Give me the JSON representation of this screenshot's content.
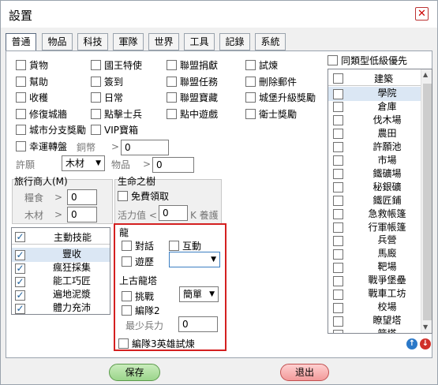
{
  "window": {
    "title": "設置"
  },
  "tabs": [
    "普通",
    "物品",
    "科技",
    "軍隊",
    "世界",
    "工具",
    "記錄",
    "系統"
  ],
  "options": {
    "col1": [
      "貨物",
      "幫助",
      "收穫",
      "修復城牆",
      "城市分支獎勵",
      "幸運轉盤"
    ],
    "col2": [
      "國王特使",
      "簽到",
      "日常",
      "點擊士兵",
      "VIP寶箱"
    ],
    "col3": [
      "聯盟捐獻",
      "聯盟任務",
      "聯盟寶藏",
      "點中遊戲"
    ],
    "col4": [
      "試煉",
      "刪除郵件",
      "城堡升級獎勵",
      "衛士獎勵"
    ]
  },
  "lucky": {
    "coins_label": "銅幣",
    "gt": ">",
    "value": "0"
  },
  "tribute": {
    "label": "許願",
    "select": "木材",
    "item_label": "物品",
    "gt": ">",
    "value": "0"
  },
  "merchant": {
    "title": "旅行商人(M)",
    "food_label": "糧食",
    "wood_label": "木材",
    "gt": ">",
    "food": "0",
    "wood": "0"
  },
  "lifetree": {
    "title": "生命之樹",
    "free_label": "免費領取",
    "vit_label": "活力值 <",
    "vit": "0",
    "k_label": "K 養護"
  },
  "skills": {
    "header": "主動技能",
    "items": [
      {
        "label": "豐收",
        "checked": true
      },
      {
        "label": "瘋狂採集",
        "checked": true
      },
      {
        "label": "能工巧匠",
        "checked": true
      },
      {
        "label": "遍地泥漿",
        "checked": true
      },
      {
        "label": "體力充沛",
        "checked": true
      }
    ]
  },
  "dragon": {
    "title": "龍",
    "dialog": "對話",
    "interact": "互動",
    "travel": "遊歷",
    "dropdown": ""
  },
  "ancient": {
    "title": "上古龍塔",
    "challenge": "挑戰",
    "difficulty": "簡單",
    "team2": "編隊2",
    "min_troops_label": "最少兵力",
    "min_troops": "0"
  },
  "team3": {
    "label": "編隊3英雄試煉"
  },
  "buildings": {
    "option_label": "同類型低級優先",
    "header": "建築",
    "items": [
      "學院",
      "倉庫",
      "伐木場",
      "農田",
      "許願池",
      "市場",
      "鐵礦場",
      "秘銀礦",
      "鐵匠鋪",
      "急救帳篷",
      "行軍帳篷",
      "兵營",
      "馬廄",
      "靶場",
      "戰爭堡壘",
      "戰車工坊",
      "校場",
      "瞭望塔",
      "箭塔"
    ]
  },
  "buttons": {
    "save": "保存",
    "exit": "退出"
  },
  "colors": {
    "accent": "#1b5e9a",
    "highlight_box": "#d42020",
    "save": "#9bd58b",
    "exit": "#f29a9a"
  }
}
